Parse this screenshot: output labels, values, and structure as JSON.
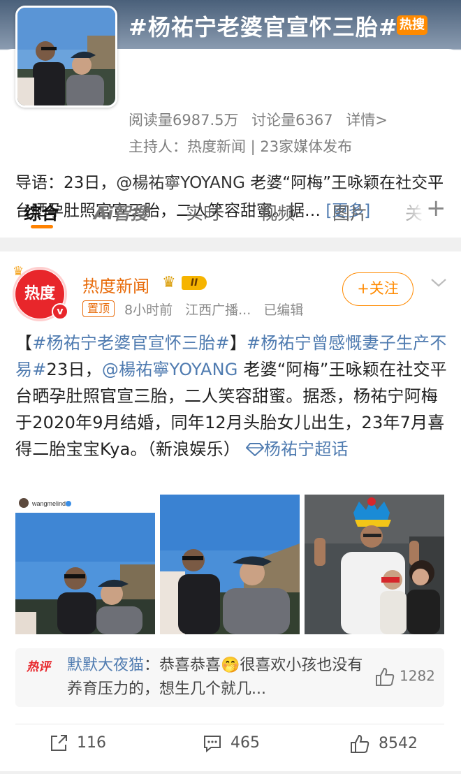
{
  "topic": {
    "title": "#杨祐宁老婆官宣怀三胎#",
    "hot_tag": "热搜",
    "reads": "阅读量6987.5万",
    "discussions": "讨论量6367",
    "details": "详情>",
    "host": "主持人：热度新闻 | 23家媒体发布",
    "lead_prefix": "导语：23日，",
    "lead_mention": "@楊祐寧YOYANG",
    "lead_rest": " 老婆“阿梅”王咏颖在社交平台晒孕肚照官宣三胎，二人笑容甜蜜。据…",
    "more": "[更多]"
  },
  "tabs": [
    {
      "label": "综合",
      "active": true
    },
    {
      "label": "Ai智搜",
      "active": false
    },
    {
      "label": "实时",
      "active": false
    },
    {
      "label": "视频",
      "active": false
    },
    {
      "label": "图片",
      "active": false
    },
    {
      "label": "关",
      "active": false
    }
  ],
  "tab_plus": "+",
  "post": {
    "account_name": "热度新闻",
    "avatar_text": "热度",
    "vip_level": "II",
    "pinned": "置顶",
    "time": "8小时前",
    "source": "江西广播...",
    "edited": "已编辑",
    "follow_label": "+关注",
    "body_prefix": "【",
    "tag1": "#杨祐宁老婆官宣怀三胎#",
    "body_mid": "】",
    "tag2": "#杨祐宁曾感慨妻子生产不易#",
    "body_date": "23日，",
    "mention": "@楊祐寧YOYANG",
    "body_rest": " 老婆“阿梅”王咏颖在社交平台晒孕肚照官宣三胎，二人笑容甜蜜。据悉，杨祐宁阿梅于2020年9月结婚，同年12月头胎女儿出生，23年7月喜得二胎宝宝Kya。（新浪娱乐）",
    "super_topic": "杨祐宁超话",
    "photo1_caption": "wangmelinda",
    "hot_comment": {
      "tag": "热评",
      "user": "默默大夜猫",
      "text": "：恭喜恭喜🤭很喜欢小孩也没有养育压力的，想生几个就几...",
      "likes": "1282"
    },
    "reposts": "116",
    "comments": "465",
    "likes": "8542"
  },
  "colors": {
    "accent": "#ff8200",
    "link": "#4f7bb0",
    "hot_red": "#e8262b"
  }
}
